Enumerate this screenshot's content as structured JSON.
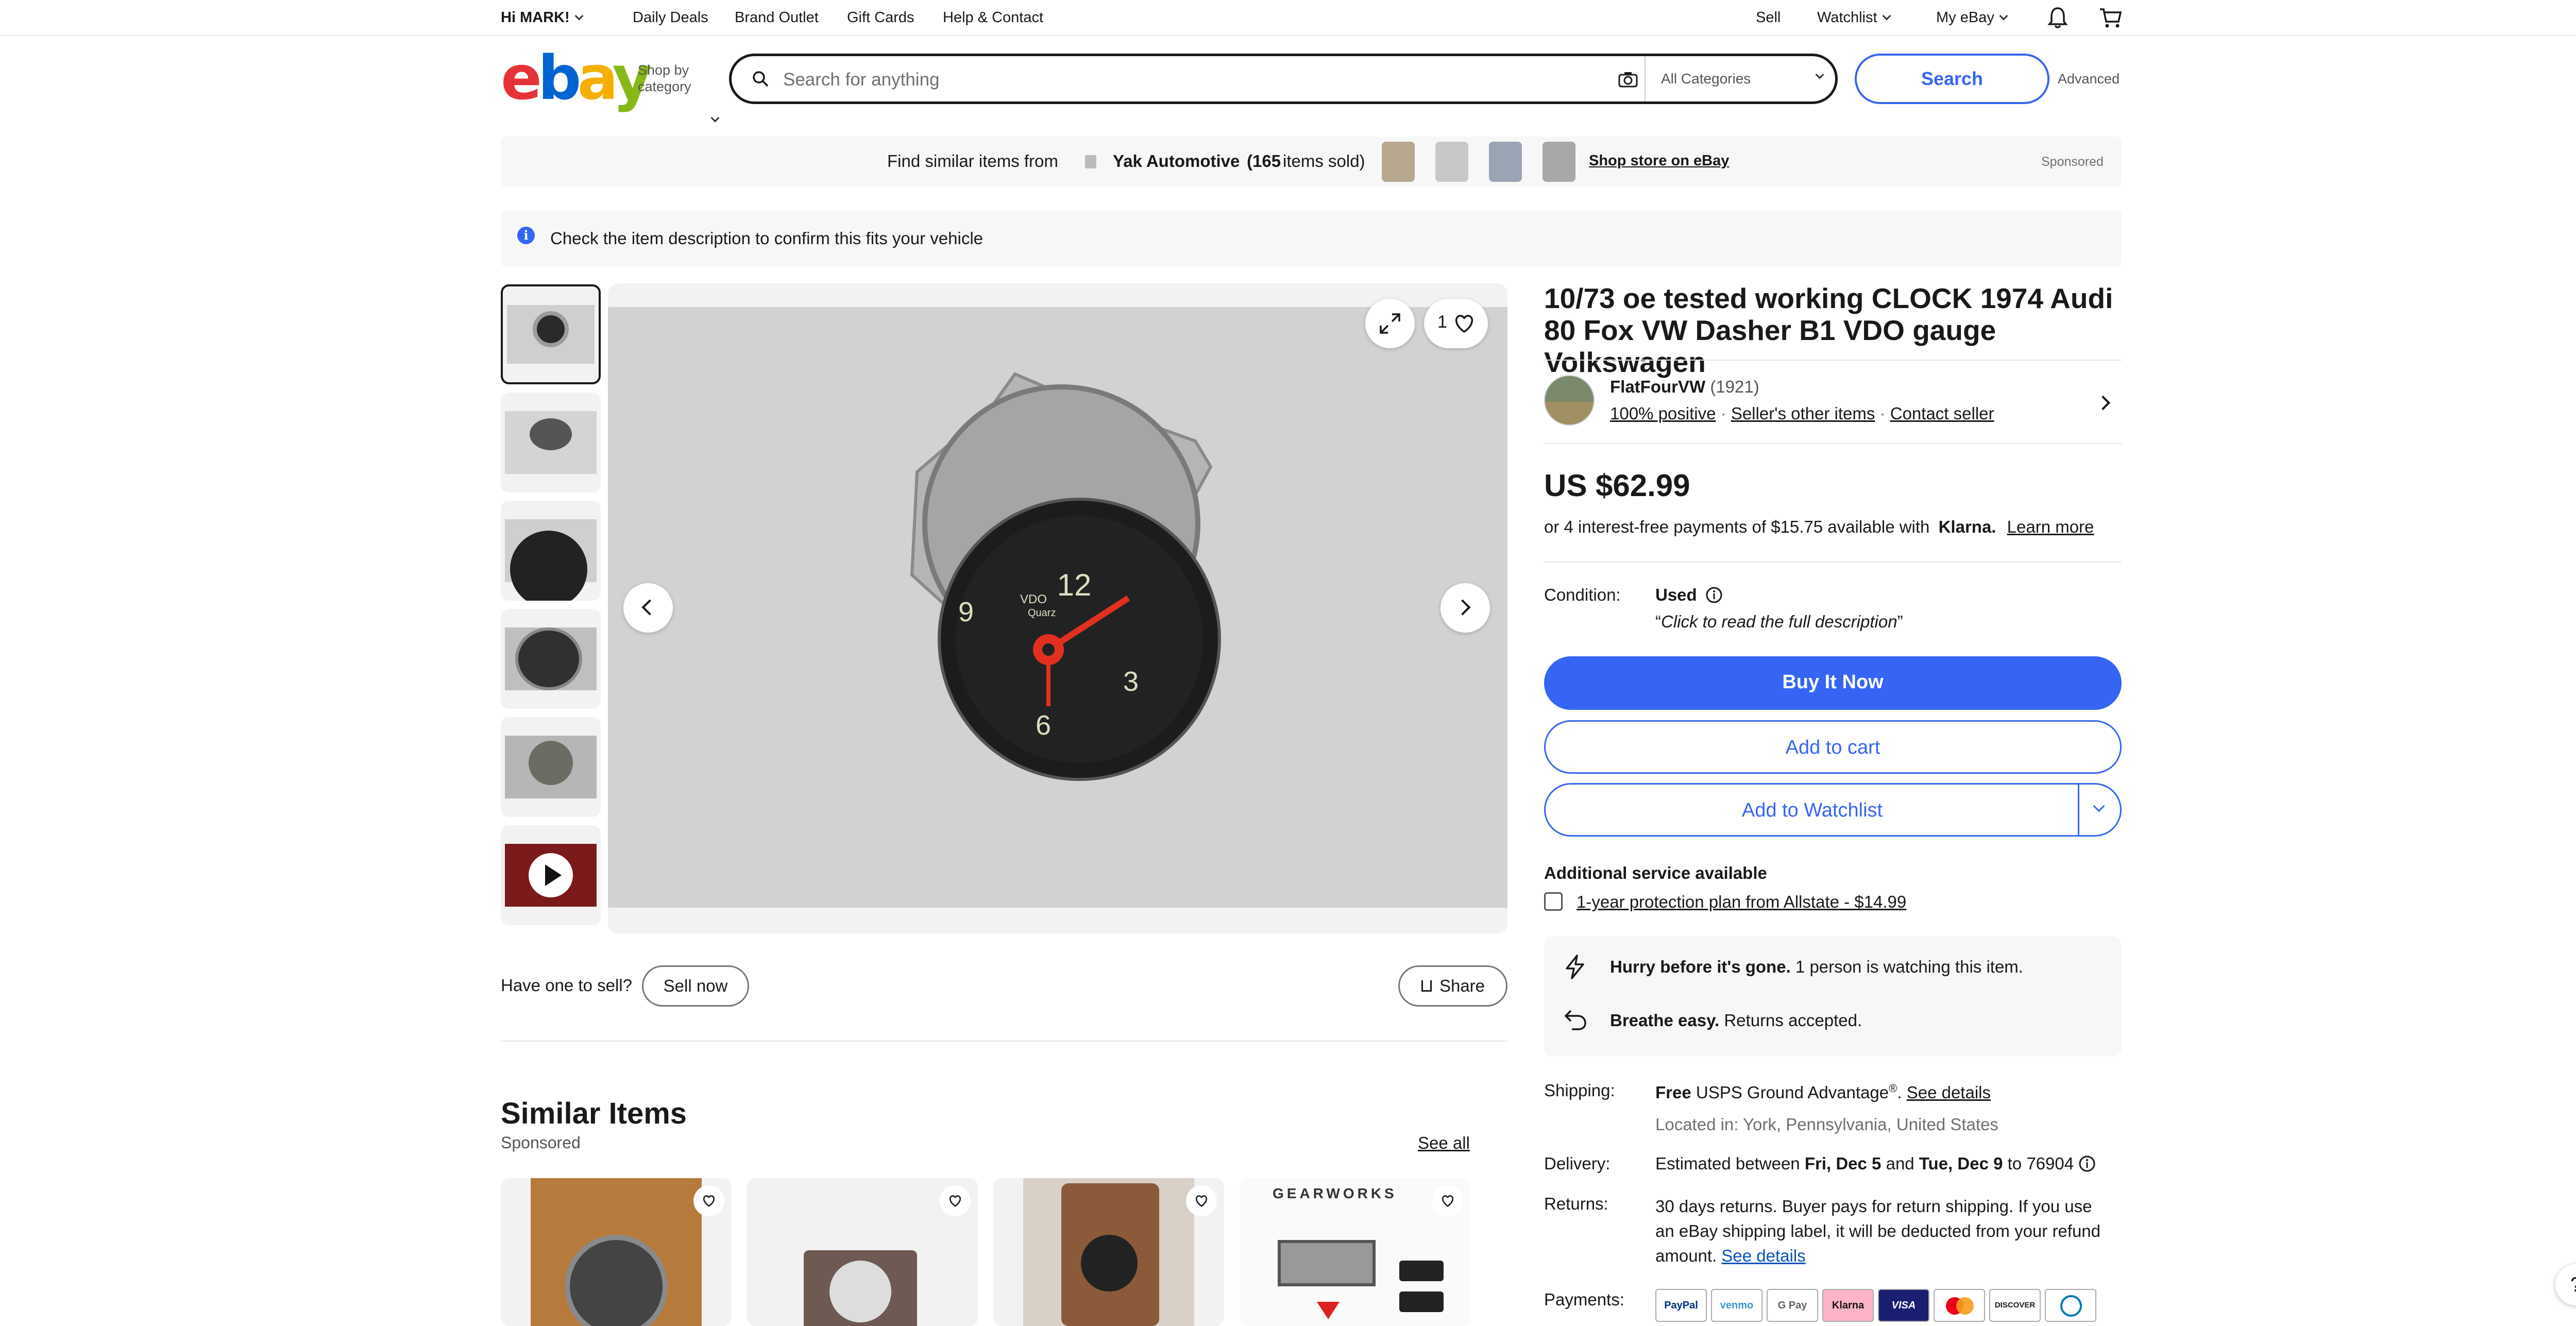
{
  "topnav": {
    "greeting": "Hi MARK!",
    "links": [
      "Daily Deals",
      "Brand Outlet",
      "Gift Cards",
      "Help & Contact"
    ],
    "sell": "Sell",
    "watchlist": "Watchlist",
    "my_ebay": "My eBay"
  },
  "header": {
    "logo": [
      "e",
      "b",
      "a",
      "y"
    ],
    "shop_by_1": "Shop by",
    "shop_by_2": "category",
    "search_placeholder": "Search for anything",
    "category": "All Categories",
    "search_button": "Search",
    "advanced": "Advanced"
  },
  "promo": {
    "find_similar": "Find similar items from",
    "store_name": "Yak Automotive",
    "sold_count": "(165",
    "sold_suffix": "items sold)",
    "shop_store": "Shop store on eBay",
    "sponsored": "Sponsored"
  },
  "compat": {
    "message": "Check the item description to confirm this fits your vehicle"
  },
  "gallery": {
    "watch_count": "1",
    "clock_numbers": [
      "12",
      "3",
      "6",
      "9"
    ],
    "clock_brand": "VDO",
    "clock_sub": "Quarz"
  },
  "below_gallery": {
    "have_one": "Have one to sell?",
    "sell_now": "Sell now",
    "share": "Share"
  },
  "item": {
    "title": "10/73 oe tested working CLOCK 1974 Audi 80 Fox VW Dasher B1 VDO gauge Volkswagen",
    "seller_name": "FlatFourVW",
    "seller_score": "(1921)",
    "positive": "100% positive",
    "other_items": "Seller's other items",
    "contact": "Contact seller",
    "price": "US $62.99",
    "klarna_text": "or 4 interest-free payments of $15.75 available with",
    "klarna_brand": "Klarna.",
    "learn_more": "Learn more",
    "condition_label": "Condition:",
    "condition_value": "Used",
    "condition_desc": "Click to read the full description",
    "buy_now": "Buy It Now",
    "add_cart": "Add to cart",
    "add_watchlist": "Add to Watchlist",
    "additional_service": "Additional service available",
    "protection_plan": "1-year protection plan from Allstate - $14.99",
    "hurry_bold": "Hurry before it's gone.",
    "hurry_text": "1 person is watching this item.",
    "breathe_bold": "Breathe easy.",
    "breathe_text": "Returns accepted.",
    "shipping_label": "Shipping:",
    "shipping_free": "Free",
    "shipping_method": "USPS Ground Advantage",
    "shipping_reg": "®",
    "see_details": "See details",
    "located": "Located in: York, Pennsylvania, United States",
    "delivery_label": "Delivery:",
    "delivery_text_1": "Estimated between",
    "delivery_date_1": "Fri, Dec 5",
    "delivery_and": "and",
    "delivery_date_2": "Tue, Dec 9",
    "delivery_to": "to 76904",
    "returns_label": "Returns:",
    "returns_line1": "30 days returns. Buyer pays for return shipping. If you use",
    "returns_line2": "an eBay shipping label, it will be deducted from your refund",
    "returns_line3": "amount.",
    "returns_see": "See details",
    "payments_label": "Payments:",
    "payment_methods": [
      "PayPal",
      "venmo",
      "G Pay",
      "Klarna",
      "VISA",
      "MC",
      "DISCOVER",
      "Diners"
    ]
  },
  "similar": {
    "heading": "Similar Items",
    "sponsored": "Sponsored",
    "see_all": "See all",
    "card4_brand": "GEARWORKS"
  },
  "help": "?"
}
